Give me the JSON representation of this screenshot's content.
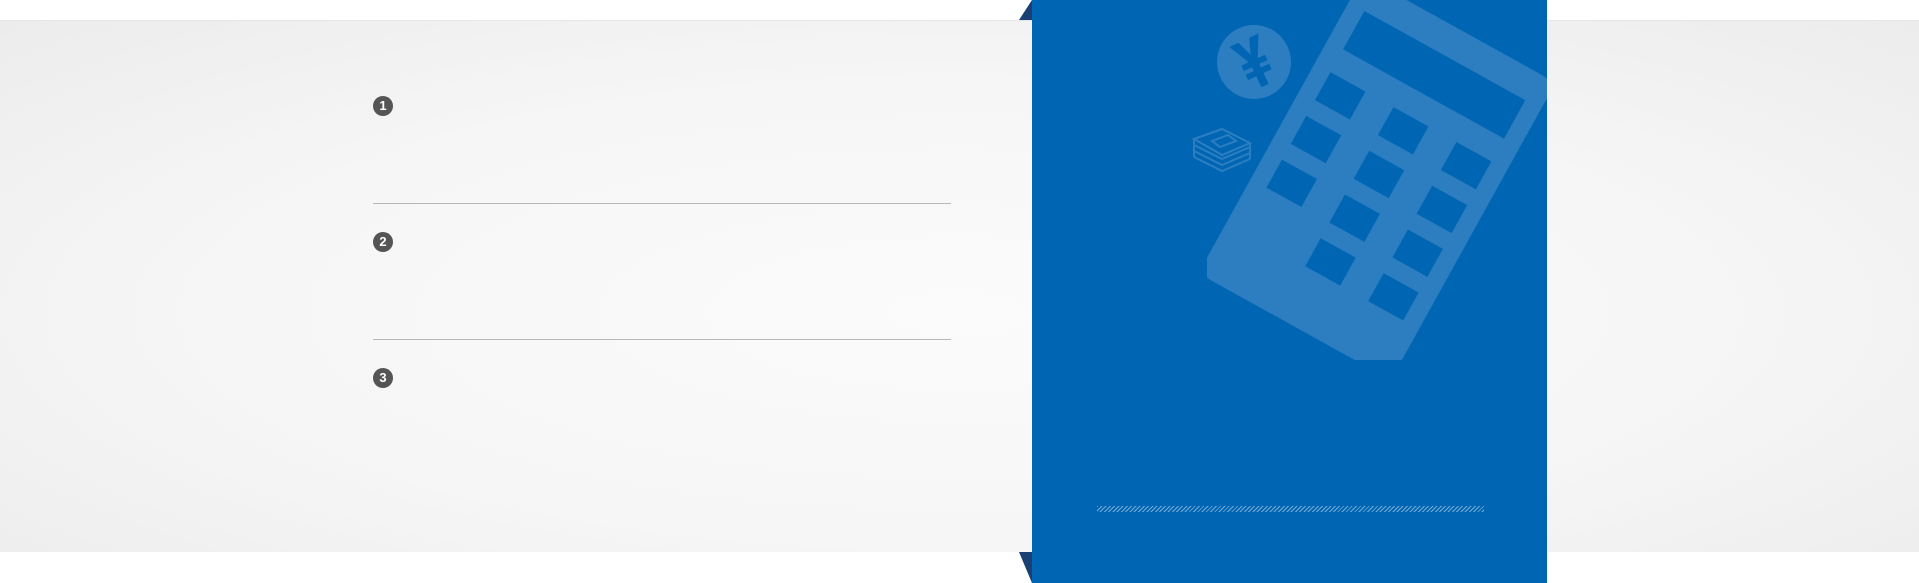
{
  "steps": [
    {
      "number": "1"
    },
    {
      "number": "2"
    },
    {
      "number": "3"
    }
  ],
  "icons": {
    "calculator": "calculator-icon",
    "yen": "yen-coin-icon",
    "money": "money-stack-icon"
  },
  "colors": {
    "panel": "#0066b3",
    "icon_overlay": "#2c7ec0",
    "step_badge": "#555555",
    "background": "#f5f5f5"
  }
}
